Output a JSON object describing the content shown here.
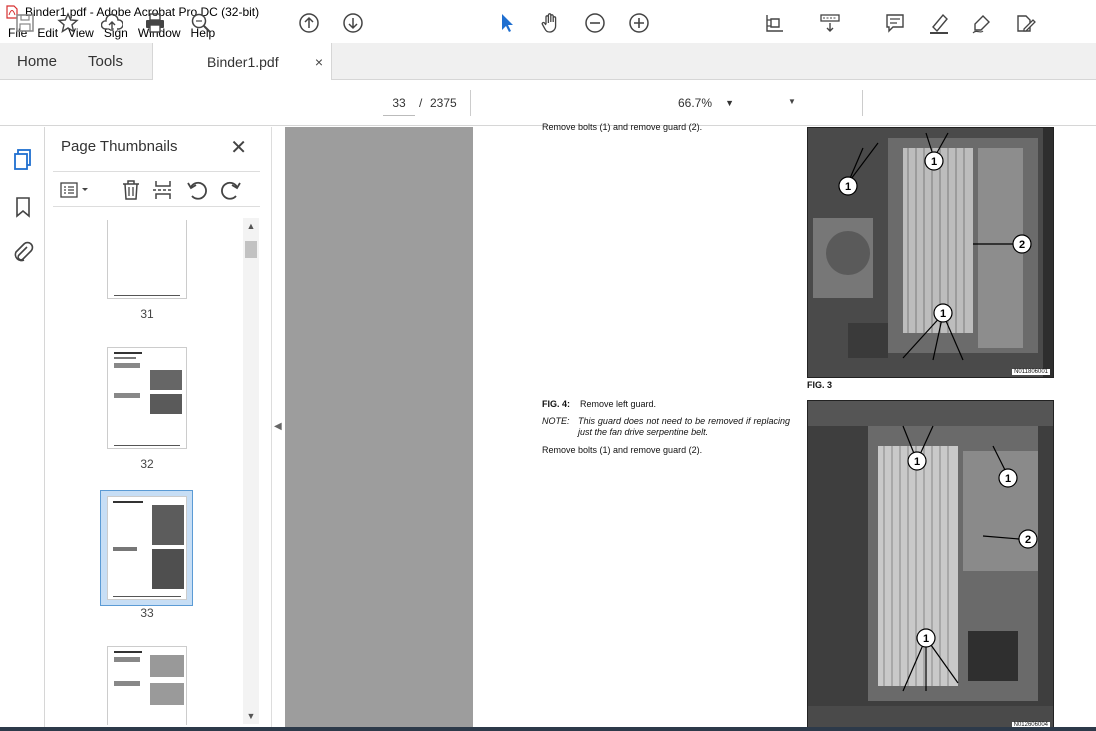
{
  "window": {
    "title": "Binder1.pdf - Adobe Acrobat Pro DC (32-bit)"
  },
  "menu": [
    "File",
    "Edit",
    "View",
    "Sign",
    "Window",
    "Help"
  ],
  "tabs": {
    "home": "Home",
    "tools": "Tools",
    "document": "Binder1.pdf",
    "close": "×"
  },
  "toolbar": {
    "current_page": "33",
    "page_sep": "/",
    "total_pages": "2375",
    "zoom": "66.7%",
    "icons": [
      "save-icon",
      "bookmark-star-icon",
      "upload-icon",
      "print-icon",
      "search-icon",
      "prev-page-icon",
      "next-page-icon",
      "select-cursor-icon",
      "hand-icon",
      "zoom-out-icon",
      "zoom-in-icon",
      "fit-page-icon",
      "scroll-mode-icon",
      "comment-icon",
      "highlight-icon",
      "sign-icon",
      "edit-pdf-icon"
    ]
  },
  "rail": [
    "thumbnails-icon",
    "bookmarks-icon",
    "attachments-icon"
  ],
  "panel": {
    "title": "Page Thumbnails",
    "close": "✕",
    "thumbs": [
      {
        "num": "31"
      },
      {
        "num": "32"
      },
      {
        "num": "33",
        "selected": true
      },
      {
        "num": ""
      }
    ]
  },
  "page": {
    "top_text": "Remove bolts (1) and remove guard (2).",
    "fig3_caption": "FIG. 3",
    "fig3_id": "N011806001",
    "fig4_label": "FIG. 4:",
    "fig4_text": "Remove left guard.",
    "note_label": "NOTE:",
    "note_text": "This guard does not need to be removed if replacing just the fan drive serpentine belt.",
    "step_text": "Remove bolts (1) and remove guard (2).",
    "fig4_id": "N012606004",
    "callouts": [
      "1",
      "1",
      "2",
      "1",
      "1",
      "1",
      "2",
      "1"
    ]
  },
  "colors": {
    "selection": "#c7def5",
    "doc_bg": "#9d9d9d",
    "accent_blue": "#1f6fd0"
  }
}
